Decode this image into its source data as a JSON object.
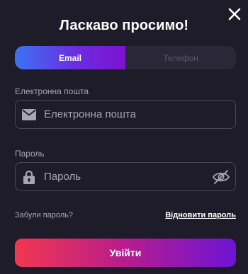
{
  "modal": {
    "title": "Ласкаво просимо!",
    "close_icon": "close-icon"
  },
  "tabs": [
    {
      "label": "Email",
      "active": true
    },
    {
      "label": "Телефон",
      "active": false
    }
  ],
  "email": {
    "label": "Електронна пошта",
    "placeholder": "Електронна пошта",
    "value": "",
    "icon": "envelope-icon"
  },
  "password": {
    "label": "Пароль",
    "placeholder": "Пароль",
    "value": "",
    "icon": "lock-icon",
    "toggle_icon": "eye-slash-icon"
  },
  "forgot": {
    "question": "Забули пароль?",
    "restore_link": "Відновити пароль"
  },
  "submit": {
    "label": "Увійти"
  },
  "colors": {
    "background": "#1e1c29",
    "tab_gradient_start": "#3c73f2",
    "tab_gradient_end": "#7d12cf",
    "button_gradient_start": "#f2374f",
    "button_gradient_end": "#6d14d5",
    "muted_text": "#a7a5b6"
  }
}
